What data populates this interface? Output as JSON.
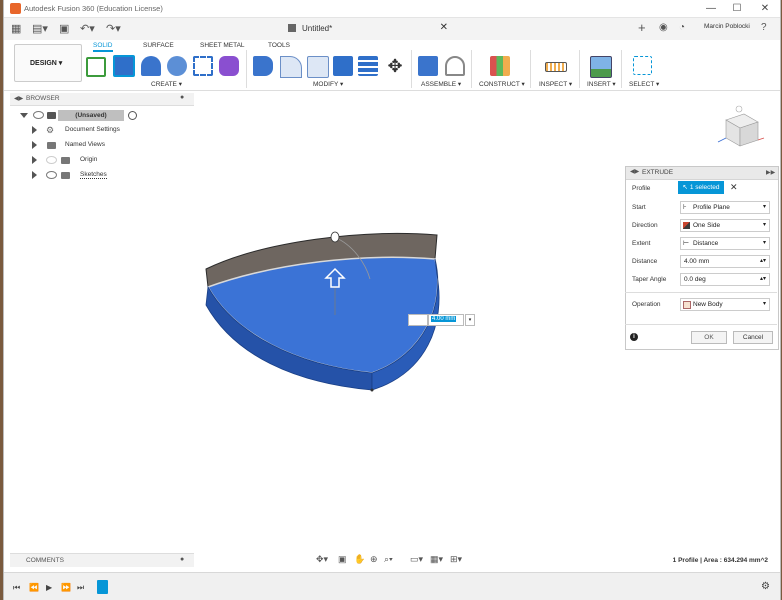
{
  "window": {
    "title": "Autodesk Fusion 360 (Education License)",
    "document_title": "Untitled*",
    "user_name": "Marcin Poblocki",
    "min_symbol": "—",
    "max_symbol": "☐",
    "close_symbol": "✕"
  },
  "ribbon": {
    "workspace_label": "DESIGN",
    "tabs": [
      "SOLID",
      "SURFACE",
      "SHEET METAL",
      "TOOLS"
    ],
    "active_tab": "SOLID",
    "groups": [
      "CREATE",
      "MODIFY",
      "ASSEMBLE",
      "CONSTRUCT",
      "INSPECT",
      "INSERT",
      "SELECT"
    ]
  },
  "browser": {
    "title": "BROWSER",
    "root": "(Unsaved)",
    "items": [
      "Document Settings",
      "Named Views",
      "Origin",
      "Sketches"
    ]
  },
  "extrude": {
    "title": "EXTRUDE",
    "rows": {
      "profile_label": "Profile",
      "profile_value": "1 selected",
      "start_label": "Start",
      "start_value": "Profile Plane",
      "direction_label": "Direction",
      "direction_value": "One Side",
      "extent_label": "Extent",
      "extent_value": "Distance",
      "distance_label": "Distance",
      "distance_value": "4.00 mm",
      "taper_label": "Taper Angle",
      "taper_value": "0.0 deg",
      "operation_label": "Operation",
      "operation_value": "New Body"
    },
    "ok_label": "OK",
    "cancel_label": "Cancel"
  },
  "viewport": {
    "dimension_value": "4.00 mm"
  },
  "comments": {
    "title": "COMMENTS"
  },
  "status": {
    "text": "1 Profile | Area : 634.294 mm^2"
  },
  "colors": {
    "accent": "#0696d7",
    "body_blue": "#2e62c1",
    "body_face": "#3b73d6",
    "rim_gray": "#6e6660"
  }
}
